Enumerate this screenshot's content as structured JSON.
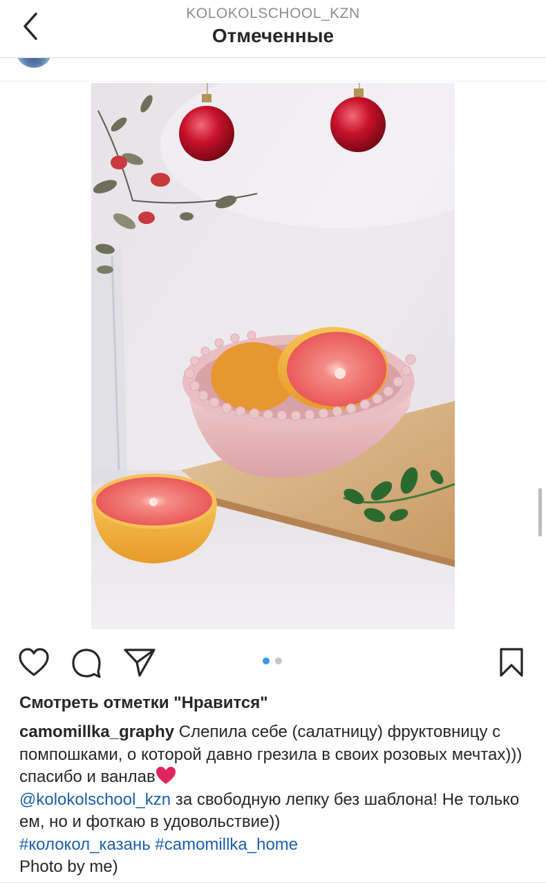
{
  "header": {
    "subtitle": "KOLOKOLSCHOOL_KZN",
    "title": "Отмеченные"
  },
  "icons": {
    "back": "chevron-left-icon",
    "like": "heart-outline-icon",
    "comment": "comment-bubble-icon",
    "share": "paper-plane-icon",
    "save": "bookmark-icon"
  },
  "carousel": {
    "count": 2,
    "active_index": 0
  },
  "post": {
    "likes_link": "Смотреть отметки \"Нравится\"",
    "caption": {
      "username": "camomillka_graphy",
      "text_1": " Слепила себе (салатницу) фруктовницу с помпошками, о которой давно грезила в своих розовых мечтах))) спасибо и ванлав",
      "mention": "@kolokolschool_kzn",
      "text_2": " за свободную лепку без шаблона! Не только ем, но и фоткаю в удовольствие)) ",
      "hashtag_1": "#колокол_казань",
      "hashtag_2": "#camomillka_home",
      "text_3": "Photo by me)"
    }
  },
  "colors": {
    "link": "#1c5fa8",
    "carousel_active": "#3897f0",
    "carousel_inactive": "#c7c7c7",
    "heart_emoji": "#e0245e"
  }
}
